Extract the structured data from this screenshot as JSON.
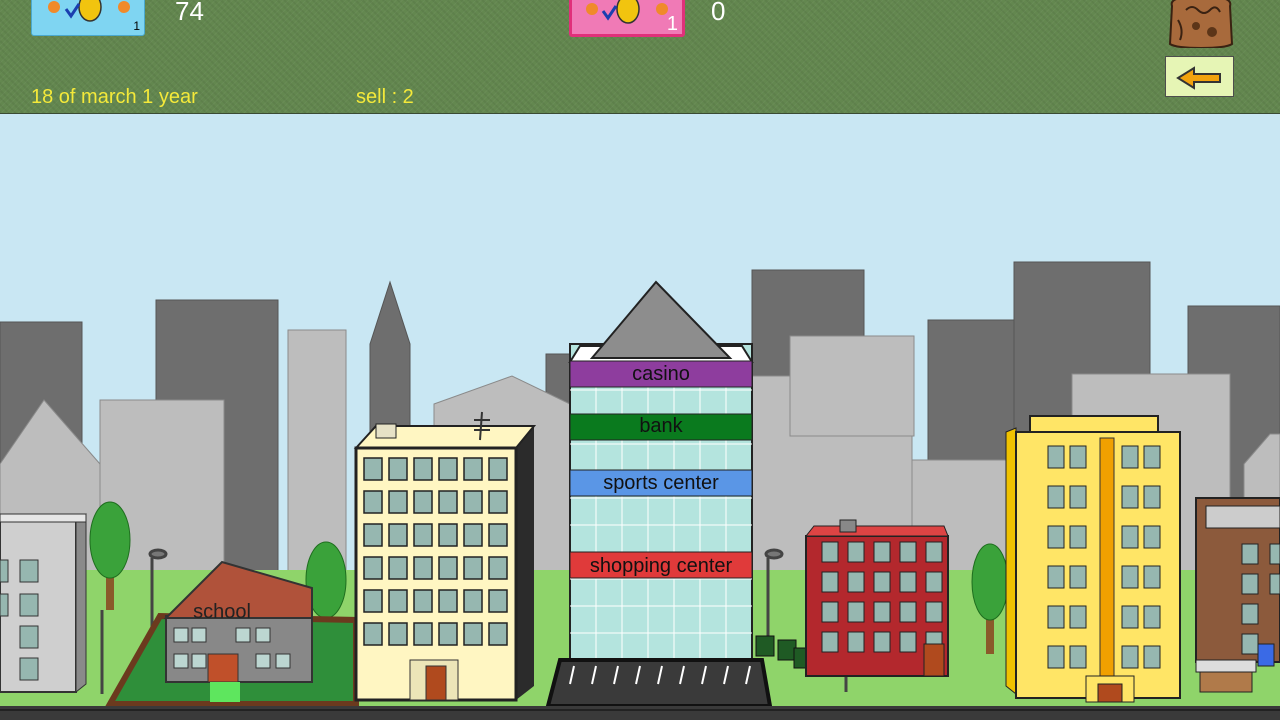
{
  "hud": {
    "player1": {
      "score": "74",
      "card_count": "1",
      "card_color": "#7fd5f2"
    },
    "player2": {
      "score": "0",
      "card_count": "1",
      "card_color": "#f07ab6"
    },
    "date": "18  of march   1  year",
    "sell": "sell :  2",
    "icons": [
      "bag-icon",
      "back-arrow-icon"
    ]
  },
  "tower_floors": {
    "casino": "casino",
    "bank": "bank",
    "sports_center": "sports center",
    "shopping_center": "shopping center"
  },
  "school_sign": "school",
  "colors": {
    "hud_bg": "#63874f",
    "hud_text": "#f4e93a",
    "sky": "#c9e7f3",
    "grass": "#8fd46a",
    "casino": "#8e3d9e",
    "bank": "#0a7a1e",
    "sports_center": "#5a96e6",
    "shopping_center": "#e03a3a"
  }
}
